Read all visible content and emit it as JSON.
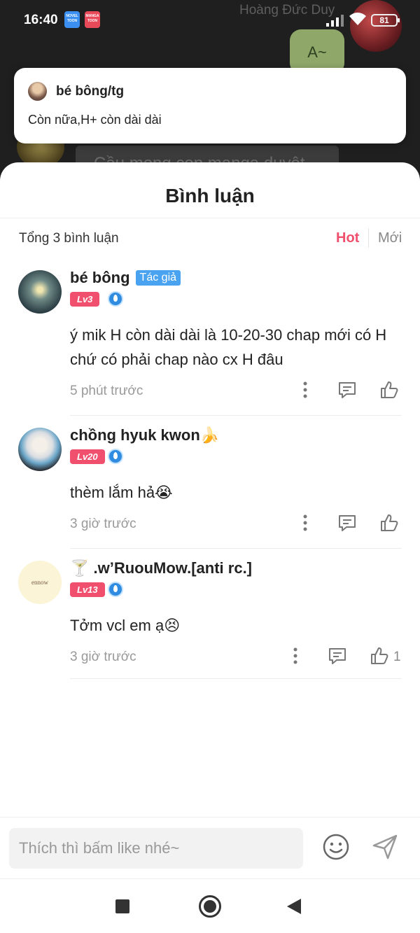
{
  "status_bar": {
    "time": "16:40",
    "battery": "81",
    "novel_badge": "NOVEL TOON",
    "manga_badge": "MANGA TOON"
  },
  "chat_background": {
    "sender_name": "Hoàng Đức Duy",
    "green_bubble_text": "A~",
    "grey_bubble_text": "Cầu mong con manga duyệt"
  },
  "notification": {
    "title": "bé bông/tg",
    "body": "Còn nữa,H+ còn dài dài"
  },
  "sheet": {
    "title": "Bình luận",
    "count_text": "Tổng 3 bình luận",
    "sort_hot": "Hot",
    "sort_new": "Mới"
  },
  "comments": [
    {
      "username": "bé bông",
      "author_tag": "Tác giả",
      "level": "Lv3",
      "text": "ý mik H còn dài dài là 10-20-30 chap mới có H chứ có phải chap nào cx H đâu",
      "time": "5 phút trước",
      "likes": ""
    },
    {
      "username": "chồng hyuk kwon🍌",
      "level": "Lv20",
      "text": "thèm lắm hả😭",
      "time": "3 giờ trước",
      "likes": ""
    },
    {
      "username": "🍸 .w’RuouMow.[anti rc.]",
      "avatar_text": "ennow",
      "level": "Lv13",
      "text": "Tởm vcl em ạ😣",
      "time": "3 giờ trước",
      "likes": "1"
    }
  ],
  "input": {
    "placeholder": "Thích thì bấm like nhé~"
  },
  "colors": {
    "accent": "#f0506e",
    "author_tag": "#4aa3f0",
    "level_badge": "#f0506e"
  }
}
